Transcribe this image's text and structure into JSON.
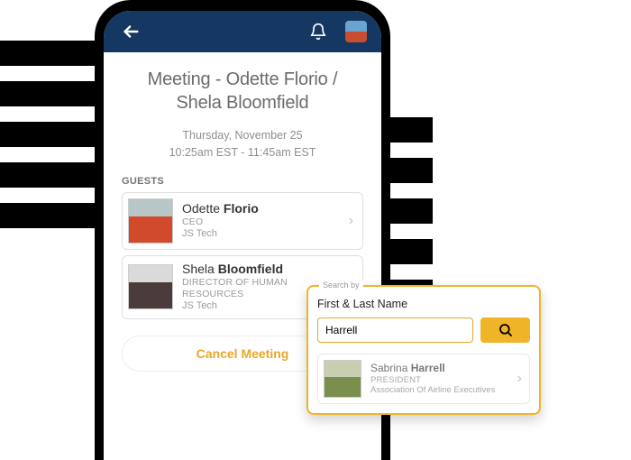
{
  "page": {
    "title_line1": "Meeting - Odette Florio /",
    "title_line2": "Shela Bloomfield",
    "date": "Thursday, November 25",
    "time": "10:25am EST - 11:45am EST",
    "guests_label": "GUESTS",
    "cancel_label": "Cancel Meeting"
  },
  "guests": [
    {
      "first": "Odette",
      "last": "Florio",
      "role": "CEO",
      "company": "JS Tech"
    },
    {
      "first": "Shela",
      "last": "Bloomfield",
      "role": "DIRECTOR OF HUMAN RESOURCES",
      "company": "JS Tech"
    }
  ],
  "search": {
    "legend": "Search by",
    "label": "First & Last Name",
    "value": "Harrell",
    "result": {
      "first": "Sabrina",
      "last": "Harrell",
      "role": "PRESIDENT",
      "company": "Association Of Airline Executives"
    }
  }
}
